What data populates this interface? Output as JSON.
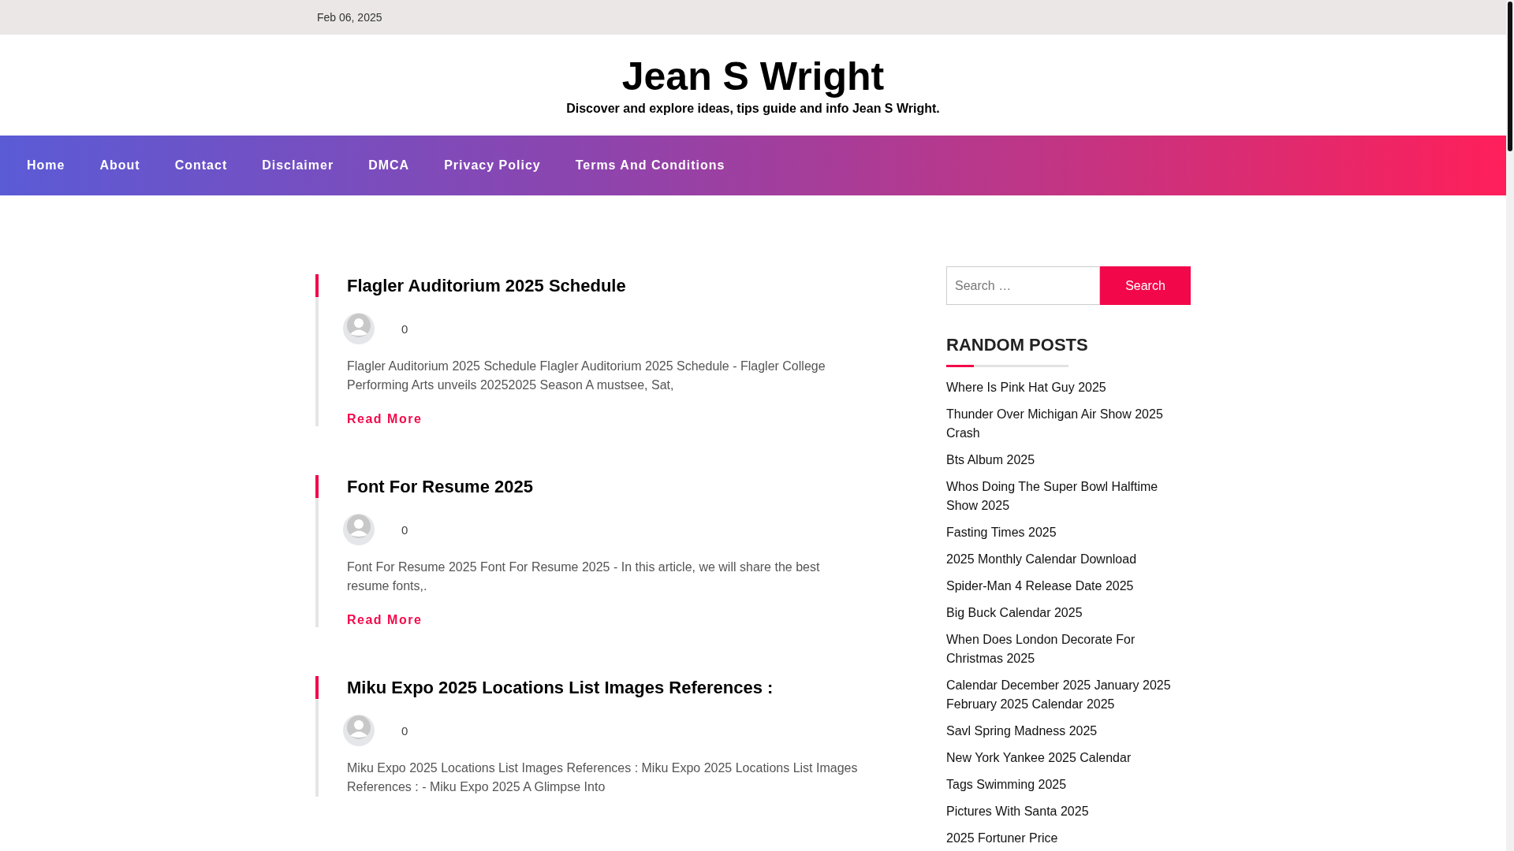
{
  "top_bar": {
    "date": "Feb 06, 2025"
  },
  "header": {
    "title": "Jean S Wright",
    "tagline": "Discover and explore ideas, tips guide and info Jean S Wright."
  },
  "nav": {
    "items": [
      {
        "label": "Home"
      },
      {
        "label": "About"
      },
      {
        "label": "Contact"
      },
      {
        "label": "Disclaimer"
      },
      {
        "label": "DMCA"
      },
      {
        "label": "Privacy Policy"
      },
      {
        "label": "Terms And Conditions"
      }
    ]
  },
  "posts": [
    {
      "title": "Flagler Auditorium 2025 Schedule",
      "comments": "0",
      "excerpt": "Flagler Auditorium 2025 Schedule Flagler Auditorium 2025 Schedule - Flagler College Performing Arts unveils 20252025 Season A mustsee, Sat,",
      "read_more": "Read More"
    },
    {
      "title": "Font For Resume 2025",
      "comments": "0",
      "excerpt": "Font For Resume 2025 Font For Resume 2025 - In this article, we will share the best resume fonts,.",
      "read_more": "Read More"
    },
    {
      "title": "Miku Expo 2025 Locations List Images References :",
      "comments": "0",
      "excerpt": "Miku Expo 2025 Locations List Images References : Miku Expo 2025 Locations List Images References : - Miku Expo 2025 A Glimpse Into"
    }
  ],
  "sidebar": {
    "search": {
      "placeholder": "Search …",
      "button": "Search"
    },
    "random_posts": {
      "heading": "RANDOM POSTS",
      "items": [
        "Where Is Pink Hat Guy 2025",
        "Thunder Over Michigan Air Show 2025 Crash",
        "Bts Album 2025",
        "Whos Doing The Super Bowl Halftime Show 2025",
        "Fasting Times 2025",
        "2025 Monthly Calendar Download",
        "Spider-Man 4 Release Date 2025",
        "Big Buck Calendar 2025",
        "When Does London Decorate For Christmas 2025",
        "Calendar December 2025 January 2025 February 2025 Calendar 2025",
        "Savl Spring Madness 2025",
        "New York Yankee 2025 Calendar",
        "Tags Swimming 2025",
        "Pictures With Santa 2025",
        "2025 Fortuner Price"
      ]
    }
  }
}
